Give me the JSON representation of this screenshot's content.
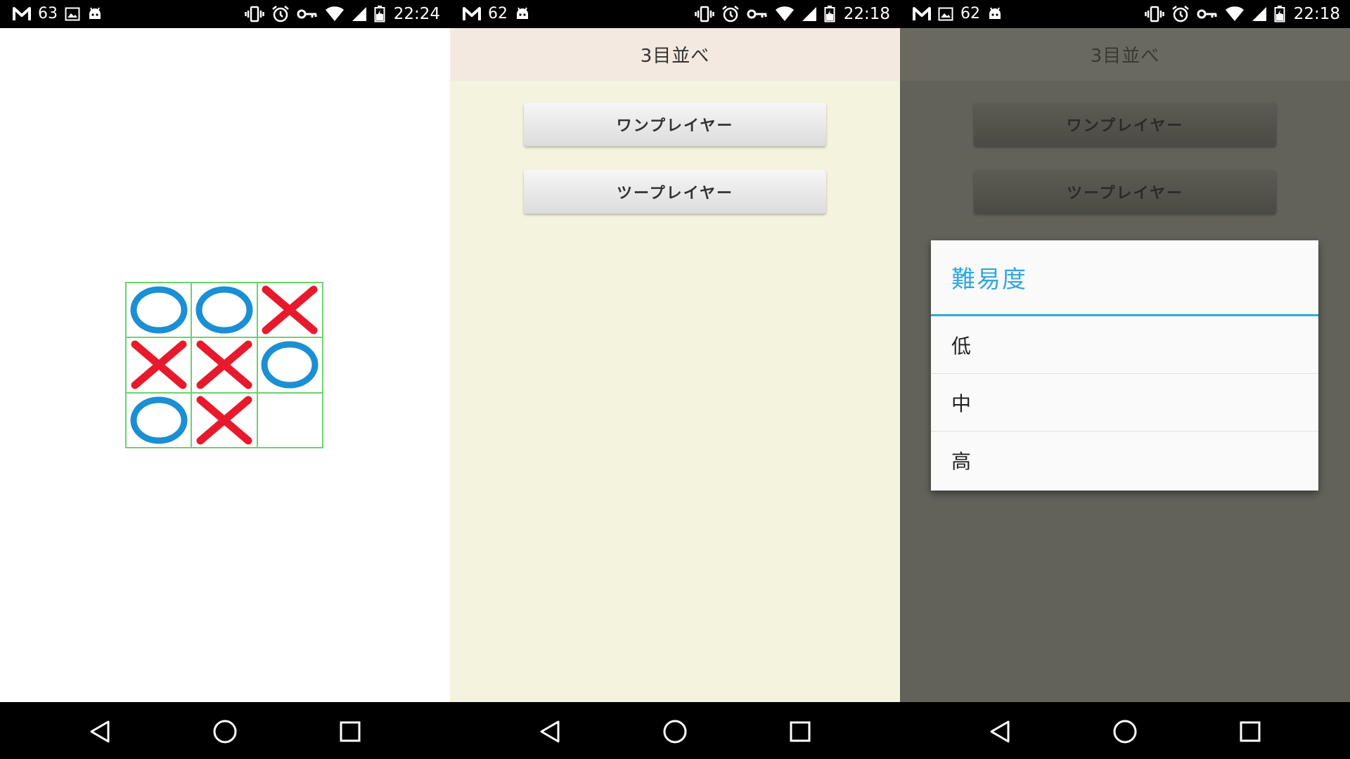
{
  "screens": [
    {
      "status_bar": {
        "battery_level": "63",
        "time": "22:24"
      },
      "board": {
        "cells": [
          "O",
          "O",
          "X",
          "X",
          "X",
          "O",
          "O",
          "X",
          ""
        ]
      }
    },
    {
      "status_bar": {
        "battery_level": "62",
        "time": "22:18"
      },
      "header": {
        "title": "3目並べ"
      },
      "buttons": {
        "one_player": "ワンプレイヤー",
        "two_player": "ツープレイヤー"
      }
    },
    {
      "status_bar": {
        "battery_level": "62",
        "time": "22:18"
      },
      "header": {
        "title": "3目並べ"
      },
      "buttons": {
        "one_player": "ワンプレイヤー",
        "two_player": "ツープレイヤー"
      },
      "dialog": {
        "title": "難易度",
        "options": [
          "低",
          "中",
          "高"
        ]
      }
    }
  ],
  "colors": {
    "o_mark": "#1a8fd4",
    "x_mark": "#e8192c",
    "grid_line": "#6fd16f",
    "menu_background": "#f4f3de",
    "header_background": "#f4e9e0",
    "dim_background": "#62625b",
    "dim_header": "#696960",
    "dialog_accent": "#33a8dc"
  },
  "icons": {
    "status_left": [
      "gmail-icon",
      "image-icon",
      "android-icon"
    ],
    "status_right": [
      "vibrate-icon",
      "alarm-icon",
      "vpn-key-icon",
      "wifi-icon",
      "signal-icon",
      "battery-icon"
    ],
    "nav": [
      "back-icon",
      "home-icon",
      "recents-icon"
    ]
  }
}
